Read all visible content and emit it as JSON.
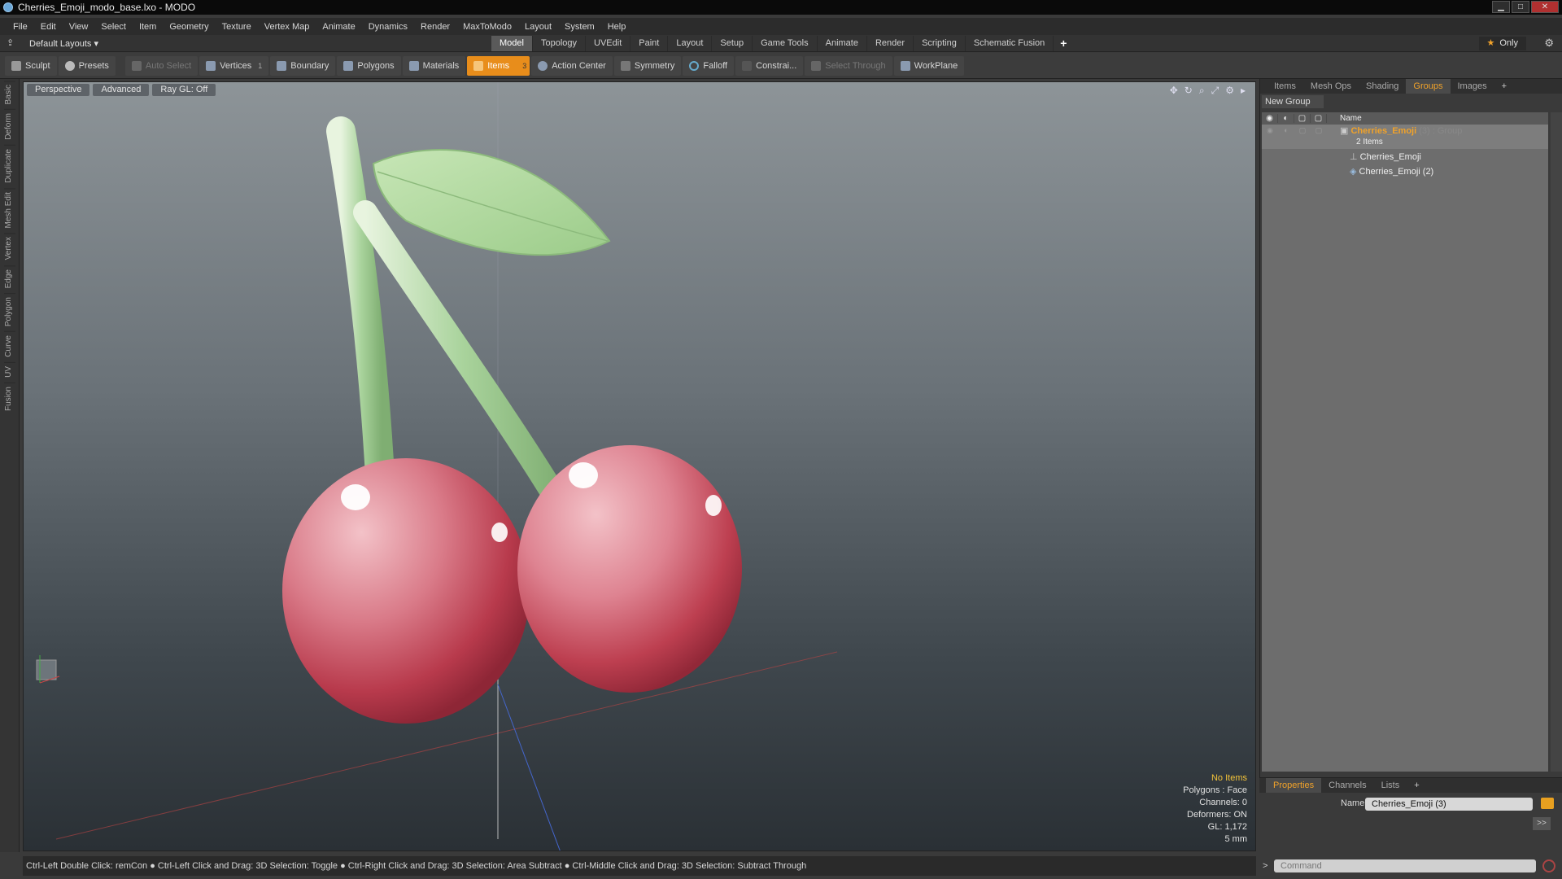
{
  "window": {
    "title": "Cherries_Emoji_modo_base.lxo - MODO"
  },
  "menu": [
    "File",
    "Edit",
    "View",
    "Select",
    "Item",
    "Geometry",
    "Texture",
    "Vertex Map",
    "Animate",
    "Dynamics",
    "Render",
    "MaxToModo",
    "Layout",
    "System",
    "Help"
  ],
  "layoutbar": {
    "layout_dropdown": "Default Layouts",
    "tabs": [
      "Model",
      "Topology",
      "UVEdit",
      "Paint",
      "Layout",
      "Setup",
      "Game Tools",
      "Animate",
      "Render",
      "Scripting",
      "Schematic Fusion"
    ],
    "active_tab": "Model",
    "only_label": "Only"
  },
  "toolbar": {
    "sculpt": "Sculpt",
    "presets": "Presets",
    "auto_select": "Auto Select",
    "vertices": "Vertices",
    "vertices_count": "1",
    "boundary": "Boundary",
    "polygons": "Polygons",
    "materials": "Materials",
    "items": "Items",
    "items_count": "3",
    "action_center": "Action Center",
    "symmetry": "Symmetry",
    "falloff": "Falloff",
    "constraint": "Constrai...",
    "select_through": "Select Through",
    "workplane": "WorkPlane"
  },
  "left_tabs": [
    "Basic",
    "Deform",
    "Duplicate",
    "Mesh Edit",
    "Vertex",
    "Edge",
    "Polygon",
    "Curve",
    "UV",
    "Fusion"
  ],
  "viewport": {
    "view_mode": "Perspective",
    "shading": "Advanced",
    "raygl": "Ray GL: Off",
    "info": {
      "items": "No Items",
      "polygons": "Polygons : Face",
      "channels": "Channels: 0",
      "deformers": "Deformers: ON",
      "gl": "GL: 1,172",
      "scale": "5 mm"
    }
  },
  "right_panel": {
    "tabs": [
      "Items",
      "Mesh Ops",
      "Shading",
      "Groups",
      "Images"
    ],
    "active_tab": "Groups",
    "new_group": "New Group",
    "column_name": "Name",
    "group": {
      "name": "Cherries_Emoji",
      "suffix": "(3) : Group",
      "count_label": "2 Items",
      "children": [
        "Cherries_Emoji",
        "Cherries_Emoji (2)"
      ]
    }
  },
  "properties": {
    "tabs": [
      "Properties",
      "Channels",
      "Lists"
    ],
    "active_tab": "Properties",
    "name_label": "Name",
    "name_value": "Cherries_Emoji (3)",
    "arrow": ">>"
  },
  "status": {
    "text": "Ctrl-Left Double Click: remCon ● Ctrl-Left Click and Drag: 3D Selection: Toggle ● Ctrl-Right Click and Drag: 3D Selection: Area Subtract ● Ctrl-Middle Click and Drag: 3D Selection: Subtract Through"
  },
  "command": {
    "placeholder": "Command"
  },
  "colors": {
    "accent": "#e88d1b",
    "cherry": "#c94a5a",
    "stem": "#a9d39c"
  }
}
